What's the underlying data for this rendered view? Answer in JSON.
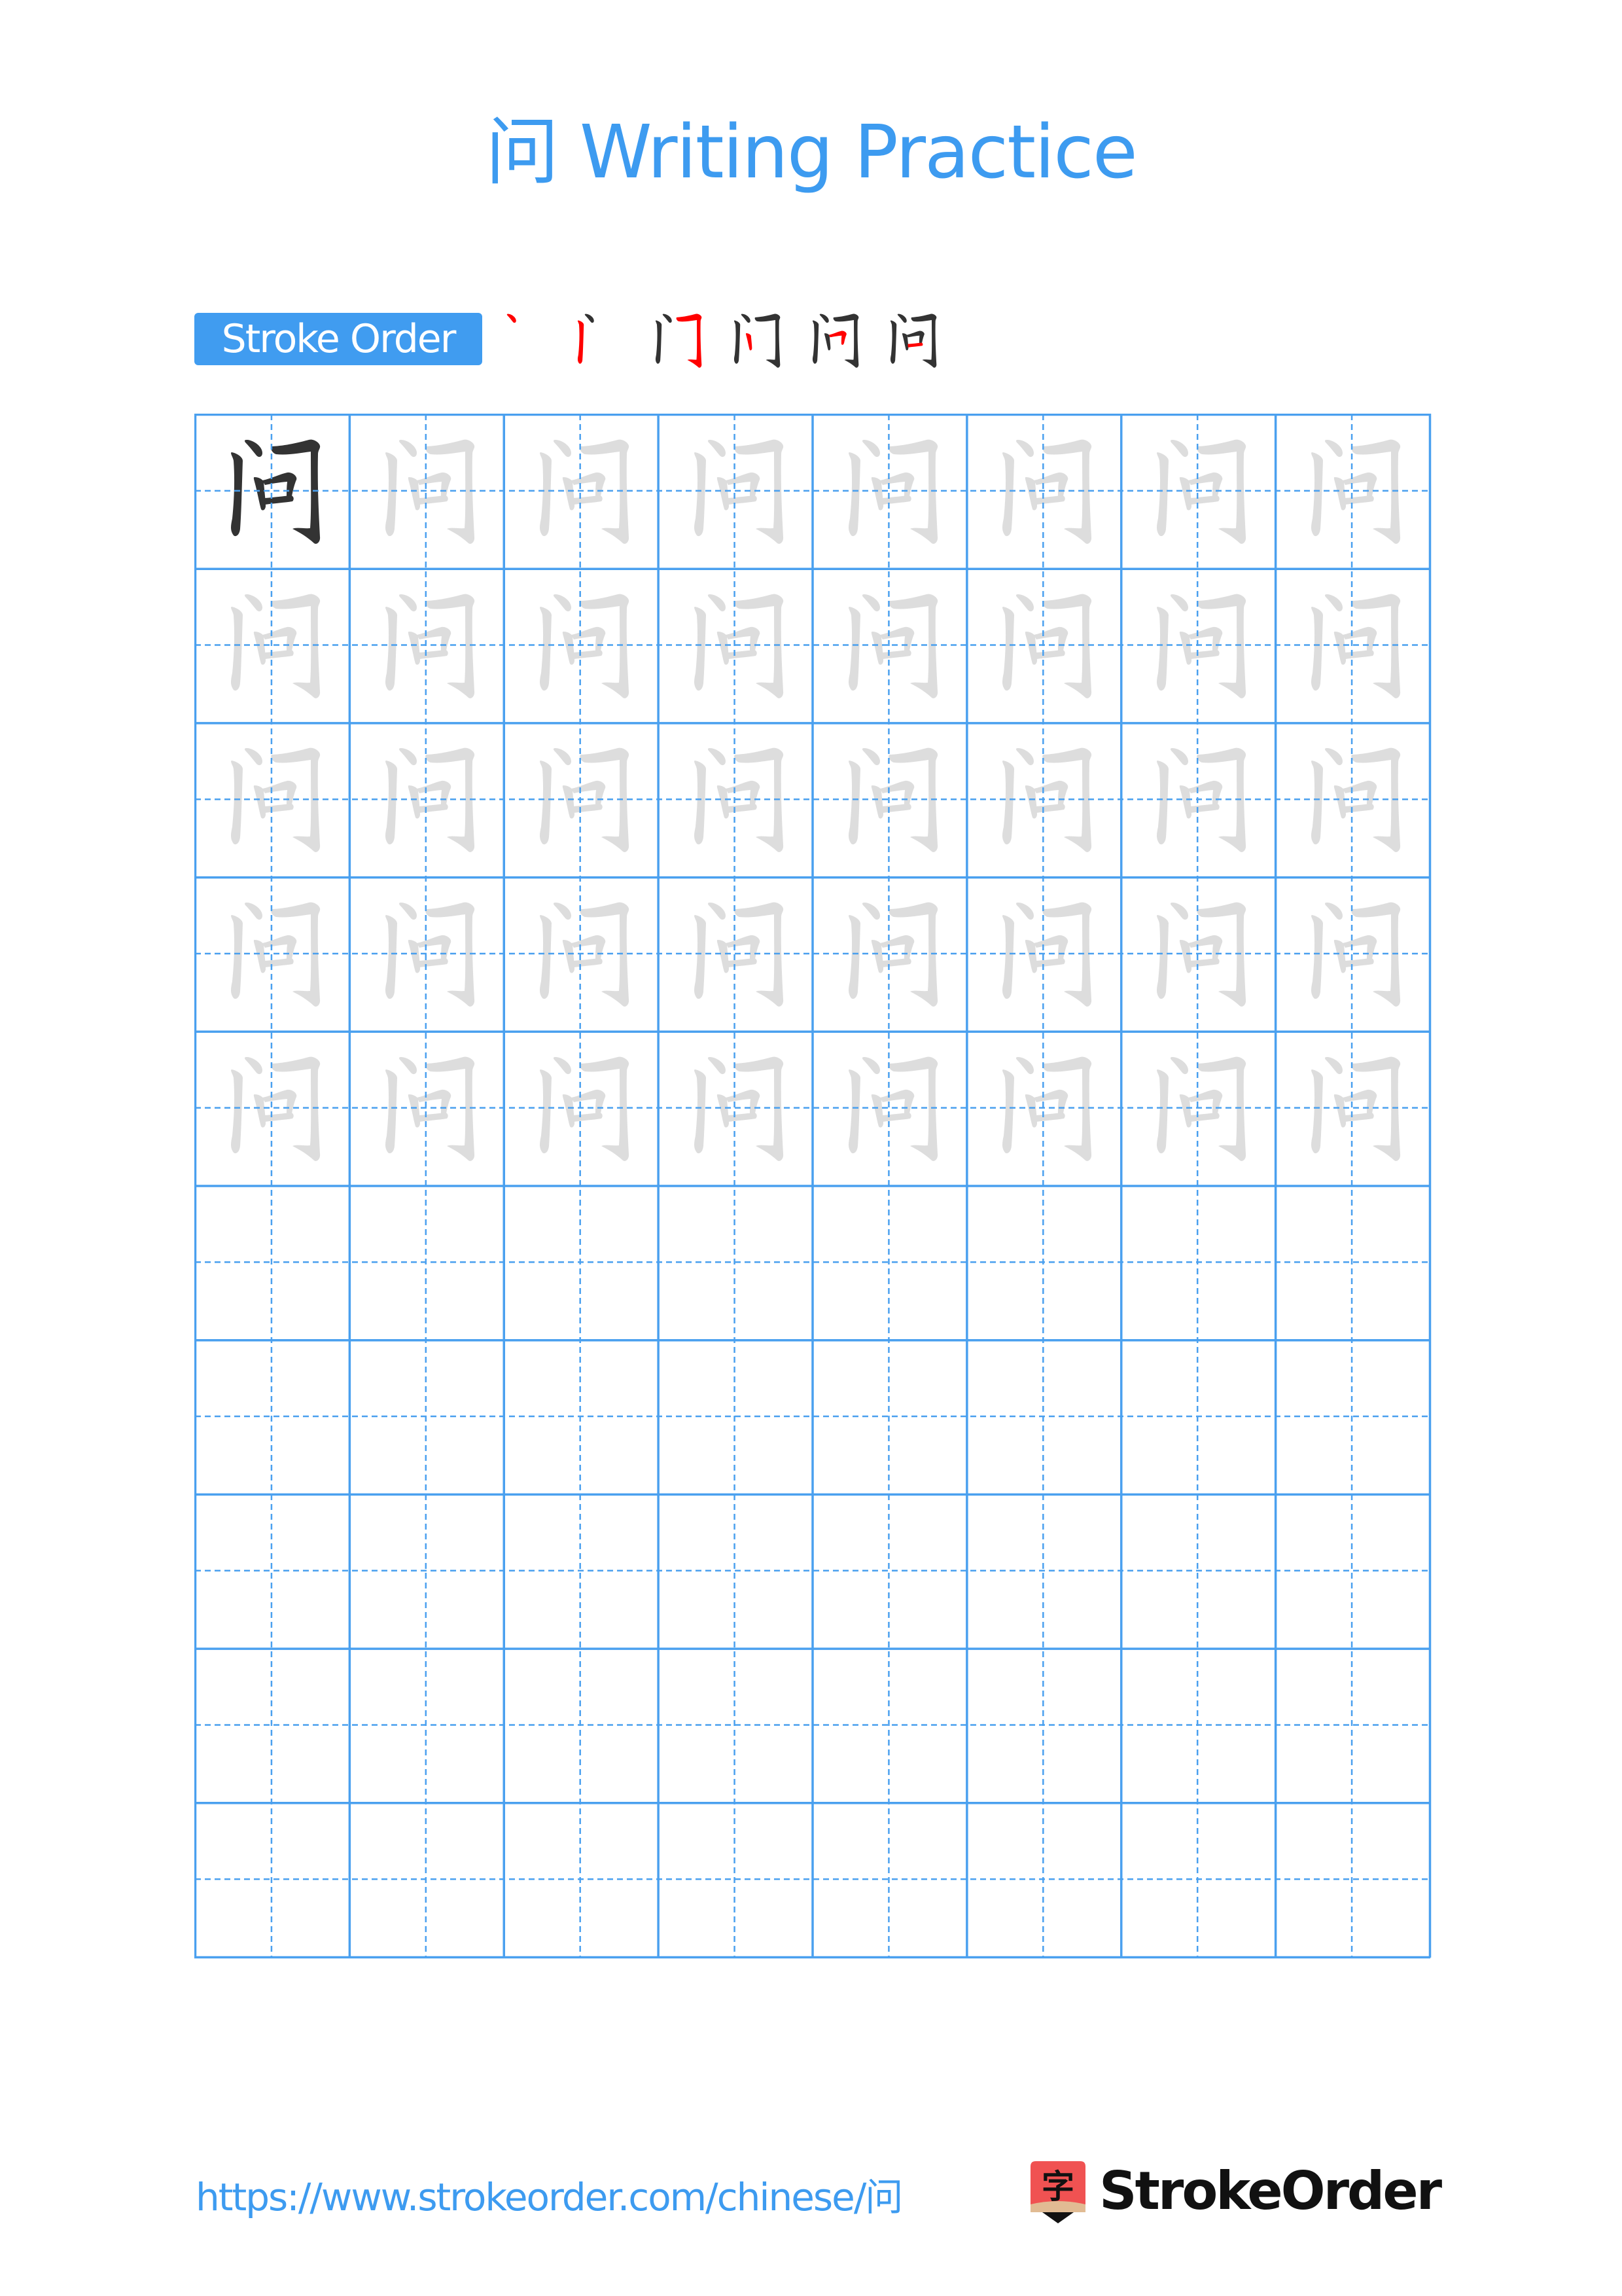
{
  "page": {
    "title": "问 Writing Practice",
    "character": "问"
  },
  "stroke_order": {
    "label": "Stroke Order",
    "stroke_count": 6,
    "steps": [
      {
        "step": 1,
        "highlight_stroke": 1
      },
      {
        "step": 2,
        "highlight_stroke": 2
      },
      {
        "step": 3,
        "highlight_stroke": 3
      },
      {
        "step": 4,
        "highlight_stroke": 4
      },
      {
        "step": 5,
        "highlight_stroke": 5
      },
      {
        "step": 6,
        "highlight_stroke": 6
      }
    ]
  },
  "grid": {
    "rows": 10,
    "cols": 8,
    "model_cells": 1,
    "trace_rows": 5,
    "empty_rows": 5
  },
  "colors": {
    "accent": "#3d9bf0",
    "grid_line": "#4aa0ef",
    "model_char": "#333333",
    "trace_char": "#dddddd",
    "stroke_highlight": "#ff0000",
    "logo_red": "#f05252",
    "logo_tan": "#e1bb93"
  },
  "footer": {
    "url": "https://www.strokeorder.com/chinese/问",
    "brand": "StrokeOrder",
    "logo_glyph": "字"
  }
}
